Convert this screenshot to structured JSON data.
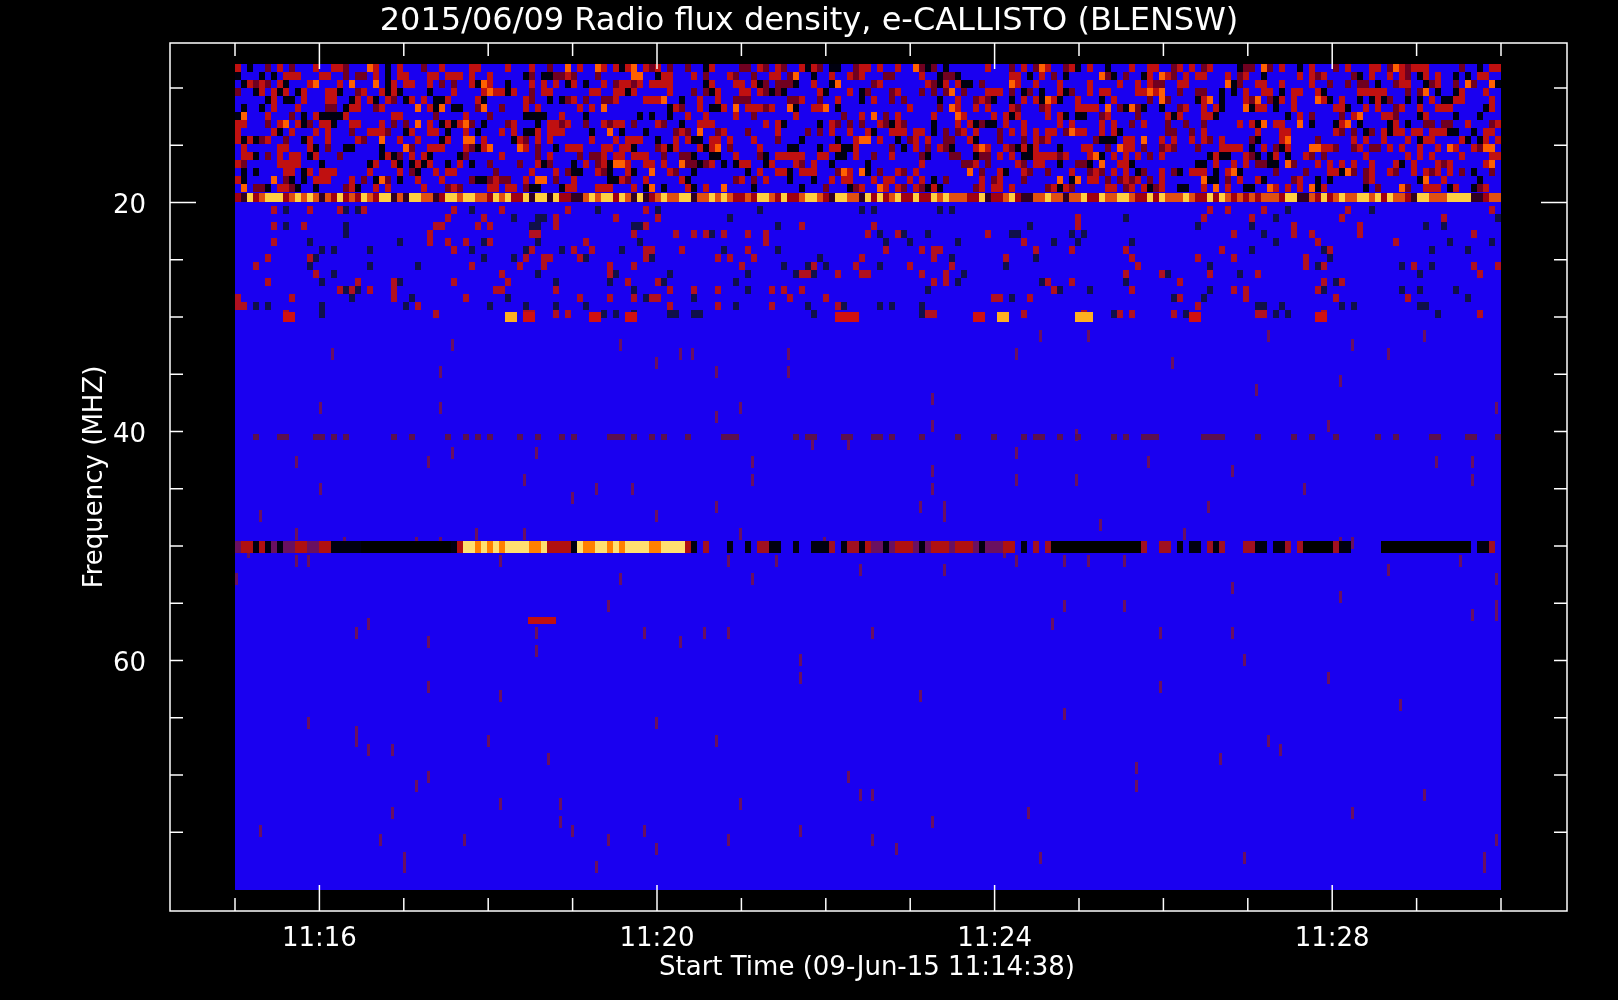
{
  "title": "2015/06/09  Radio flux density, e-CALLISTO (BLENSW)",
  "y_axis": {
    "label": "Frequency (MHZ)",
    "ticks": [
      "20",
      "40",
      "60"
    ]
  },
  "x_axis": {
    "label": "Start Time (09-Jun-15 11:14:38)",
    "ticks": [
      "11:16",
      "11:20",
      "11:24",
      "11:28"
    ]
  }
}
